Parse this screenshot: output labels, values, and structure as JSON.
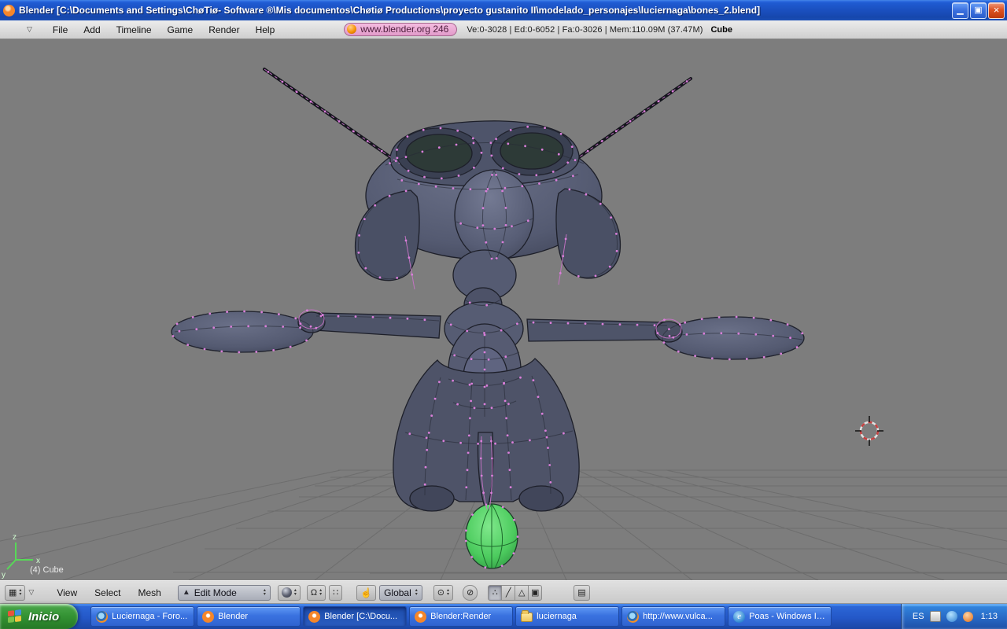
{
  "titlebar": {
    "title": "Blender [C:\\Documents and Settings\\ChøTiø- Software ®\\Mis documentos\\Chøtiø Productions\\proyecto gustanito II\\modelado_personajes\\luciernaga\\bones_2.blend]"
  },
  "icons": {
    "minimize": "▁",
    "maximize": "▣",
    "close": "×",
    "pulldown": "▽",
    "editor_grid": "▦",
    "step_up": "▴",
    "step_down": "▾",
    "mode_triangle": "▲",
    "proportional": "Ω",
    "snap_grid": "∷",
    "manipulator_hand": "☝",
    "circle_select": "⊙",
    "render_disc": "⊘",
    "vertex_mode": "∴",
    "edge_mode": "╱",
    "face_mode": "△",
    "occlude": "▣",
    "render_image": "▤",
    "ie_letter": "e"
  },
  "menubar": {
    "items": [
      "File",
      "Add",
      "Timeline",
      "Game",
      "Render",
      "Help"
    ],
    "badge": "www.blender.org 246",
    "stats": "Ve:0-3028 | Ed:0-6052 | Fa:0-3026 | Mem:110.09M (37.47M)",
    "active_object": "Cube"
  },
  "viewport": {
    "object_label": "(4) Cube",
    "vertex_color": "#db7fdb",
    "axis_x": "x",
    "axis_y": "y",
    "axis_z": "z"
  },
  "footer": {
    "menus": [
      "View",
      "Select",
      "Mesh"
    ],
    "mode": "Edit Mode",
    "orientation": "Global"
  },
  "taskbar": {
    "start_label": "Inicio",
    "tasks": [
      {
        "label": "Luciernaga - Foro..."
      },
      {
        "label": "Blender"
      },
      {
        "label": "Blender [C:\\Docu..."
      },
      {
        "label": "Blender:Render"
      },
      {
        "label": "luciernaga"
      },
      {
        "label": "http://www.vulca..."
      },
      {
        "label": "Poas - Windows In..."
      }
    ],
    "tray": {
      "lang": "ES",
      "time": "1:13"
    }
  }
}
